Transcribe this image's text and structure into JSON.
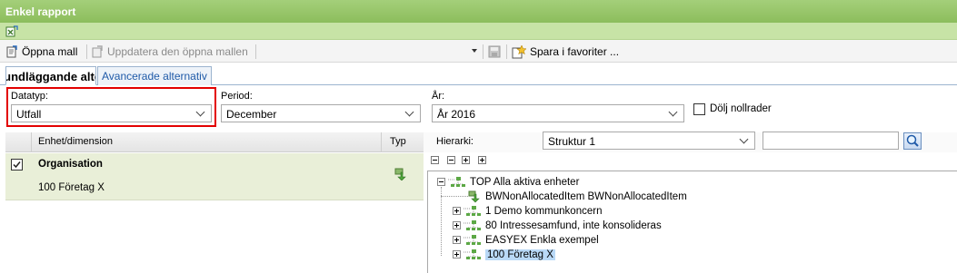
{
  "window": {
    "title": "Enkel rapport"
  },
  "toolbar": {
    "open_template": "Öppna mall",
    "update_template": "Uppdatera den öppna mallen",
    "template_select_value": "",
    "save_favorites": "Spara i favoriter ..."
  },
  "tabs": [
    {
      "label": "Grundläggande alternativ",
      "active": true
    },
    {
      "label": "Avancerade alternativ",
      "active": false
    }
  ],
  "filters": {
    "datatyp": {
      "label": "Datatyp:",
      "value": "Utfall"
    },
    "period": {
      "label": "Period:",
      "value": "December"
    },
    "year": {
      "label": "År:",
      "value": "År 2016"
    },
    "hide_zero_rows": {
      "label": "Dölj nollrader",
      "checked": false
    }
  },
  "grid": {
    "columns": [
      "Enhet/dimension",
      "Typ"
    ],
    "rows": [
      {
        "checked": true,
        "title": "Organisation",
        "value": "100 Företag X"
      }
    ]
  },
  "hierarchy": {
    "label": "Hierarki:",
    "value": "Struktur 1",
    "search_value": "",
    "tree": [
      {
        "label": "TOP Alla aktiva enheter",
        "expanded": true
      },
      {
        "label": "BWNonAllocatedItem BWNonAllocatedItem"
      },
      {
        "label": "1 Demo kommunkoncern"
      },
      {
        "label": "80 Intressesamfund, inte konsolideras"
      },
      {
        "label": "EASYEX Enkla exempel"
      },
      {
        "label": "100 Företag X",
        "selected": true
      }
    ]
  },
  "colors": {
    "title_bar": "#96c66a",
    "row_highlight": "#e9efd8",
    "selection": "#b9d9f7",
    "highlight_border": "#e30000"
  }
}
